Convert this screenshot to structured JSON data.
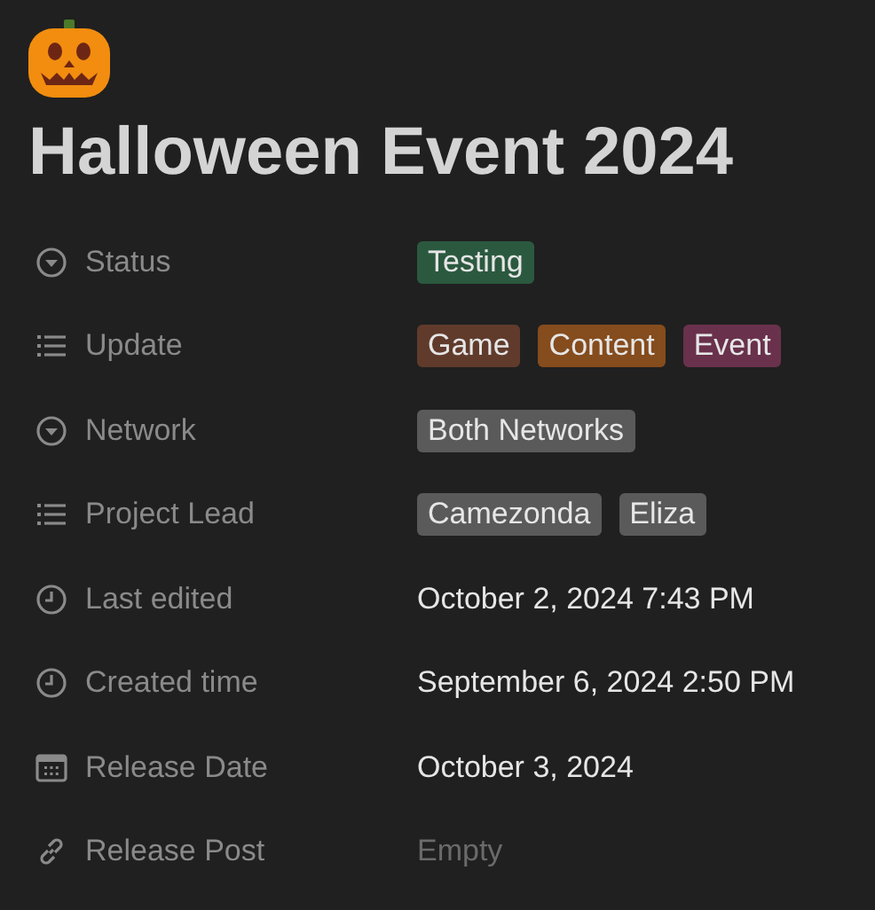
{
  "page": {
    "title": "Halloween Event 2024"
  },
  "properties": [
    {
      "kind": "select",
      "label": "Status",
      "tags": [
        {
          "text": "Testing",
          "color": "#2b593f"
        }
      ]
    },
    {
      "kind": "multi",
      "label": "Update",
      "tags": [
        {
          "text": "Game",
          "color": "#603b2c"
        },
        {
          "text": "Content",
          "color": "#854c1d"
        },
        {
          "text": "Event",
          "color": "#69314c"
        }
      ]
    },
    {
      "kind": "select",
      "label": "Network",
      "tags": [
        {
          "text": "Both Networks",
          "color": "#5a5a5a"
        }
      ]
    },
    {
      "kind": "multi",
      "label": "Project Lead",
      "tags": [
        {
          "text": "Camezonda",
          "color": "#5a5a5a"
        },
        {
          "text": "Eliza",
          "color": "#5a5a5a"
        }
      ]
    },
    {
      "kind": "time",
      "label": "Last edited",
      "value": "October 2, 2024 7:43 PM"
    },
    {
      "kind": "time",
      "label": "Created time",
      "value": "September 6, 2024 2:50 PM"
    },
    {
      "kind": "date",
      "label": "Release Date",
      "value": "October 3, 2024"
    },
    {
      "kind": "url",
      "label": "Release Post",
      "placeholder": "Empty"
    }
  ]
}
